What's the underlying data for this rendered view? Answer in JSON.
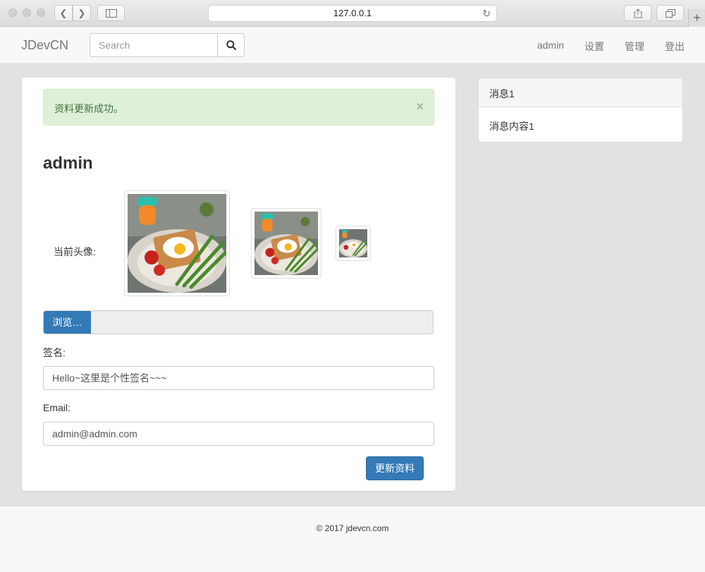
{
  "browser": {
    "url": "127.0.0.1"
  },
  "navbar": {
    "brand": "JDevCN",
    "search_placeholder": "Search",
    "links": [
      "admin",
      "设置",
      "管理",
      "登出"
    ]
  },
  "alert": {
    "message": "资料更新成功。",
    "close": "×"
  },
  "profile": {
    "username": "admin",
    "avatar_label": "当前头像:",
    "browse_label": "浏览…",
    "signature_label": "签名:",
    "signature_value": "Hello~这里是个性签名~~~",
    "email_label": "Email:",
    "email_value": "admin@admin.com",
    "submit_label": "更新资料"
  },
  "sidebar": {
    "title": "消息1",
    "content": "消息内容1"
  },
  "footer": {
    "text": "© 2017 jdevcn.com"
  },
  "colors": {
    "primary": "#337ab7",
    "alert_bg": "#dff0d8",
    "alert_text": "#3c763d"
  }
}
